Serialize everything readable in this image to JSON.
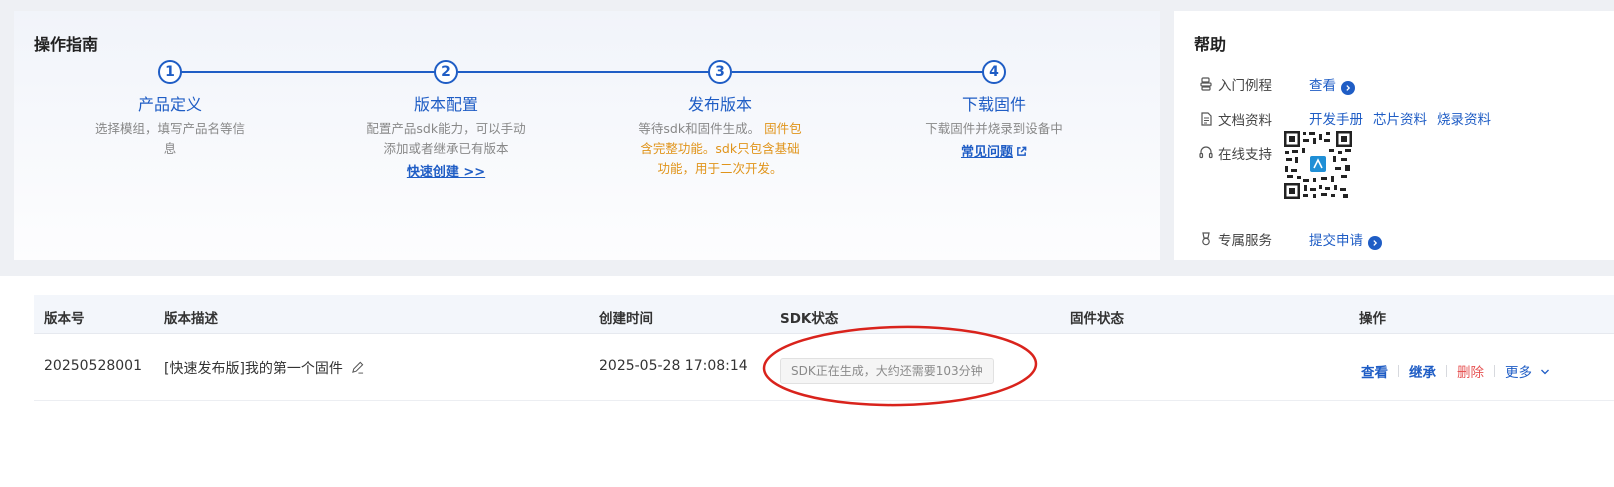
{
  "guide": {
    "title": "操作指南",
    "steps": [
      {
        "num": "1",
        "name": "产品定义",
        "desc": "选择模组，填写产品名等信息",
        "link": ""
      },
      {
        "num": "2",
        "name": "版本配置",
        "desc": "配置产品sdk能力，可以手动添加或者继承已有版本",
        "link": "快速创建 >>"
      },
      {
        "num": "3",
        "name": "发布版本",
        "desc_normal": "等待sdk和固件生成。",
        "desc_warn": "固件包含完整功能。sdk只包含基础功能，用于二次开发。",
        "link": ""
      },
      {
        "num": "4",
        "name": "下载固件",
        "desc": "下载固件并烧录到设备中",
        "link": "常见问题"
      }
    ]
  },
  "help": {
    "title": "帮助",
    "rows": [
      {
        "label": "入门例程",
        "icon": "tutorial-icon",
        "links": [
          "查看"
        ]
      },
      {
        "label": "文档资料",
        "icon": "document-icon",
        "links": [
          "开发手册",
          "芯片资料",
          "烧录资料"
        ]
      },
      {
        "label": "在线支持",
        "icon": "headset-icon",
        "links": []
      },
      {
        "label": "专属服务",
        "icon": "medal-icon",
        "links": [
          "提交申请"
        ]
      }
    ]
  },
  "table": {
    "headers": [
      "版本号",
      "版本描述",
      "创建时间",
      "SDK状态",
      "固件状态",
      "操作"
    ],
    "rows": [
      {
        "version": "20250528001",
        "description": "[快速发布版]我的第一个固件",
        "created": "2025-05-28 17:08:14",
        "sdk_status": "SDK正在生成，大约还需要103分钟",
        "firmware_status": "",
        "actions": {
          "view": "查看",
          "inherit": "继承",
          "delete": "删除",
          "more": "更多"
        }
      }
    ]
  },
  "colors": {
    "accent": "#1f5dc5",
    "warn": "#e0941a",
    "danger": "#e65454",
    "annotation": "#d9231c"
  }
}
